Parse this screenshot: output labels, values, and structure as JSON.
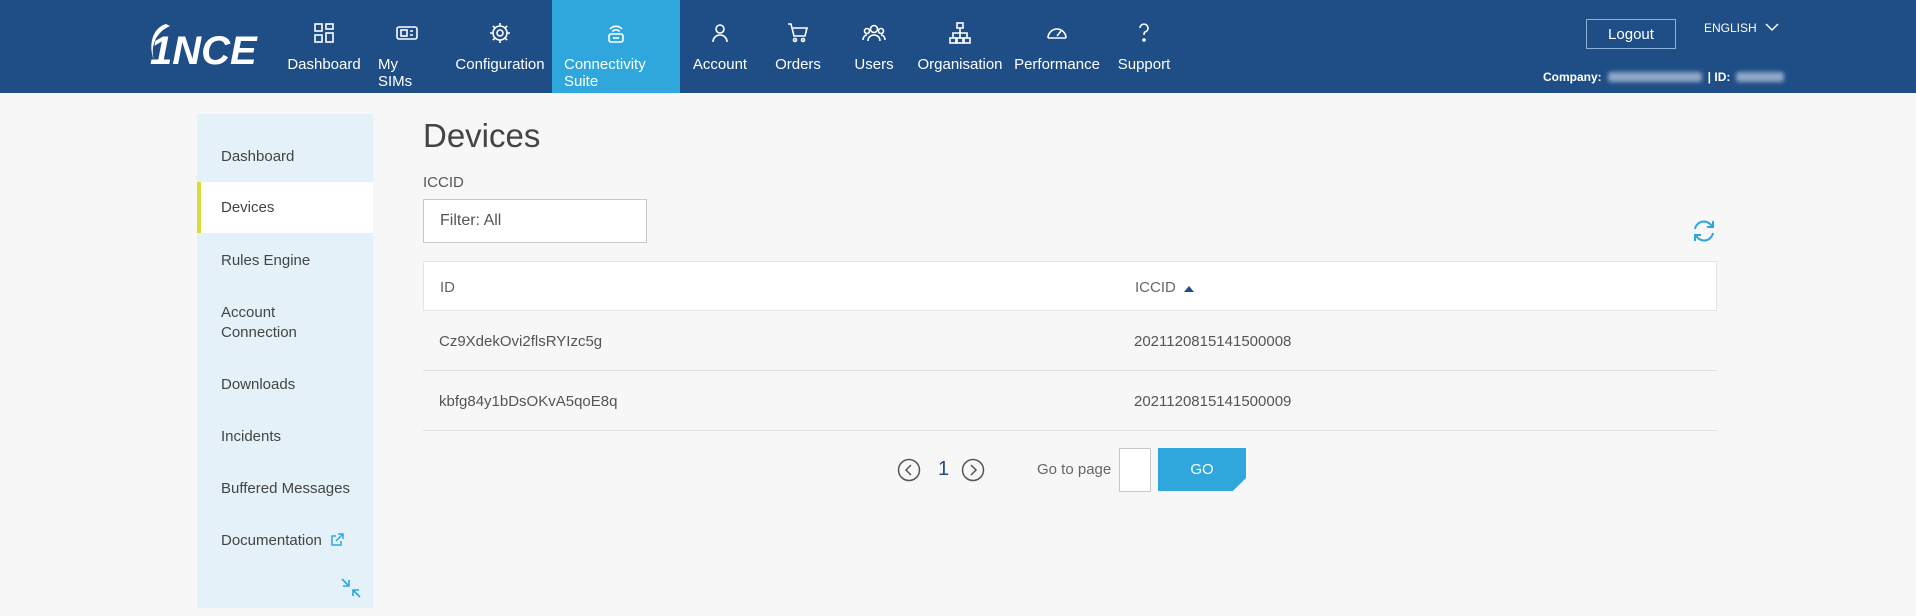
{
  "brand": {
    "logo_text": "1NCE"
  },
  "nav": {
    "items": [
      {
        "label": "Dashboard",
        "icon": "dashboard-icon"
      },
      {
        "label": "My SIMs",
        "icon": "sim-icon"
      },
      {
        "label": "Configuration",
        "icon": "gear-icon"
      },
      {
        "label": "Connectivity Suite",
        "icon": "connectivity-icon",
        "active": true
      },
      {
        "label": "Account",
        "icon": "user-icon"
      },
      {
        "label": "Orders",
        "icon": "cart-icon"
      },
      {
        "label": "Users",
        "icon": "users-icon"
      },
      {
        "label": "Organisation",
        "icon": "org-chart-icon"
      },
      {
        "label": "Performance",
        "icon": "speedometer-icon"
      },
      {
        "label": "Support",
        "icon": "question-icon"
      }
    ]
  },
  "header": {
    "logout_label": "Logout",
    "language": "ENGLISH",
    "company_label": "Company:",
    "id_label": "| ID:"
  },
  "sidebar": {
    "items": [
      {
        "label": "Dashboard"
      },
      {
        "label": "Devices",
        "active": true
      },
      {
        "label": "Rules Engine"
      },
      {
        "label": "Account Connection"
      },
      {
        "label": "Downloads"
      },
      {
        "label": "Incidents"
      },
      {
        "label": "Buffered Messages"
      },
      {
        "label": "Documentation",
        "external": true
      }
    ]
  },
  "main": {
    "title": "Devices",
    "filter_label": "ICCID",
    "filter_placeholder": "Filter: All",
    "table": {
      "columns": [
        "ID",
        "ICCID"
      ],
      "sorted_by": "ICCID",
      "rows": [
        [
          "Cz9XdekOvi2flsRYIzc5g",
          "2021120815141500008"
        ],
        [
          "kbfg84y1bDsOKvA5qoE8q",
          "2021120815141500009"
        ]
      ]
    },
    "pagination": {
      "current_page": "1",
      "goto_label": "Go to page",
      "go_label": "GO"
    }
  },
  "colors": {
    "header_bg": "#1f4d86",
    "accent": "#2fa7dd",
    "sidebar_bg": "#e4f1f8",
    "active_marker": "#d6df3a"
  }
}
